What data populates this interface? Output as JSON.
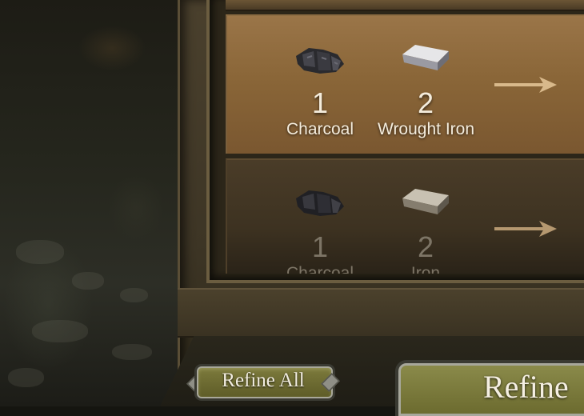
{
  "recipes": [
    {
      "state": "active",
      "inputs": [
        {
          "quantity": "1",
          "name": "Charcoal",
          "icon": "charcoal-icon"
        },
        {
          "quantity": "2",
          "name": "Wrought Iron",
          "icon": "iron-bar-icon"
        }
      ]
    },
    {
      "state": "disabled",
      "inputs": [
        {
          "quantity": "1",
          "name": "Charcoal",
          "icon": "charcoal-icon"
        },
        {
          "quantity": "2",
          "name": "Iron",
          "icon": "iron-bar-icon"
        }
      ]
    }
  ],
  "buttons": {
    "refine_all": "Refine All",
    "refine": "Refine"
  },
  "colors": {
    "active_card": "#8a6638",
    "disabled_card": "#3d3221",
    "button_green": "#6c6b2f",
    "text_light": "#f4ecdc",
    "text_dim": "#7d7566"
  }
}
